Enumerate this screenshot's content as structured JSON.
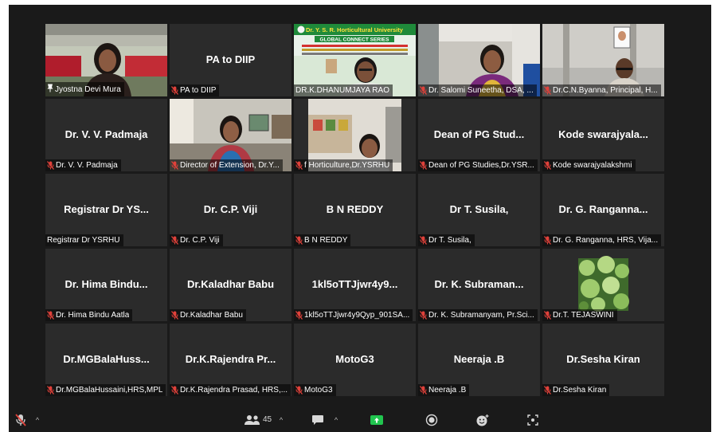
{
  "tiles": [
    {
      "type": "video",
      "scene": "woman",
      "label": "Jyostna Devi Mura",
      "icon": "pin"
    },
    {
      "type": "name",
      "display": "PA to DIIP",
      "label": "PA to DIIP",
      "icon": "mic-off"
    },
    {
      "type": "video",
      "scene": "banner",
      "label": "DR.K.DHANUMJAYA RAO",
      "icon": "none",
      "active": true,
      "banner_title": "Dr. Y. S. R. Horticultural University",
      "banner_sub": "GLOBAL CONNECT SERIES"
    },
    {
      "type": "video",
      "scene": "woman2",
      "label": "Dr. Salomi Suneetha, DSA, ...",
      "icon": "mic-off"
    },
    {
      "type": "video",
      "scene": "man",
      "label": "Dr.C.N.Byanna, Principal, H...",
      "icon": "mic-off"
    },
    {
      "type": "name",
      "display": "Dr. V. V. Padmaja",
      "label": "Dr. V. V. Padmaja",
      "icon": "mic-off"
    },
    {
      "type": "video",
      "scene": "woman3",
      "label": "Director of Extension, Dr.Y...",
      "icon": "mic-off"
    },
    {
      "type": "video",
      "scene": "man2",
      "label": "f Horticulture,Dr.YSRHU",
      "icon": "mic-off"
    },
    {
      "type": "name",
      "display": "Dean of PG Stud...",
      "label": "Dean of PG Studies,Dr.YSR...",
      "icon": "mic-off"
    },
    {
      "type": "name",
      "display": "Kode swarajyala...",
      "label": "Kode swarajyalakshmi",
      "icon": "mic-off"
    },
    {
      "type": "name",
      "display": "Registrar Dr YS...",
      "label": "Registrar Dr YSRHU",
      "icon": "none"
    },
    {
      "type": "name",
      "display": "Dr. C.P. Viji",
      "label": "Dr. C.P. Viji",
      "icon": "mic-off"
    },
    {
      "type": "name",
      "display": "B N REDDY",
      "label": "B N REDDY",
      "icon": "mic-off"
    },
    {
      "type": "name",
      "display": "Dr T. Susila,",
      "label": "Dr T. Susila,",
      "icon": "mic-off"
    },
    {
      "type": "name",
      "display": "Dr. G. Ranganna...",
      "label": "Dr. G. Ranganna, HRS, Vija...",
      "icon": "mic-off"
    },
    {
      "type": "name",
      "display": "Dr. Hima Bindu...",
      "label": "Dr. Hima Bindu Aatla",
      "icon": "mic-off"
    },
    {
      "type": "name",
      "display": "Dr.Kaladhar Babu",
      "label": "Dr.Kaladhar Babu",
      "icon": "mic-off"
    },
    {
      "type": "name",
      "display": "1kl5oTTJjwr4y9...",
      "label": "1kl5oTTJjwr4y9Qyp_901SA...",
      "icon": "mic-off"
    },
    {
      "type": "name",
      "display": "Dr. K. Subraman...",
      "label": "Dr. K. Subramanyam, Pr.Sci...",
      "icon": "mic-off"
    },
    {
      "type": "picture",
      "scene": "plants",
      "label": "Dr.T. TEJASWINI",
      "icon": "mic-off"
    },
    {
      "type": "name",
      "display": "Dr.MGBalaHuss...",
      "label": "Dr.MGBalaHussaini,HRS,MPL",
      "icon": "mic-off"
    },
    {
      "type": "name",
      "display": "Dr.K.Rajendra  Pr...",
      "label": "Dr.K.Rajendra Prasad, HRS,...",
      "icon": "mic-off"
    },
    {
      "type": "name",
      "display": "MotoG3",
      "label": "MotoG3",
      "icon": "mic-off"
    },
    {
      "type": "name",
      "display": "Neeraja .B",
      "label": "Neeraja .B",
      "icon": "mic-off"
    },
    {
      "type": "name",
      "display": "Dr.Sesha Kiran",
      "label": "Dr.Sesha Kiran",
      "icon": "mic-off"
    }
  ],
  "toolbar": {
    "participants_count": "45",
    "accent": "#21c54f",
    "mute_color": "#e0413a"
  }
}
